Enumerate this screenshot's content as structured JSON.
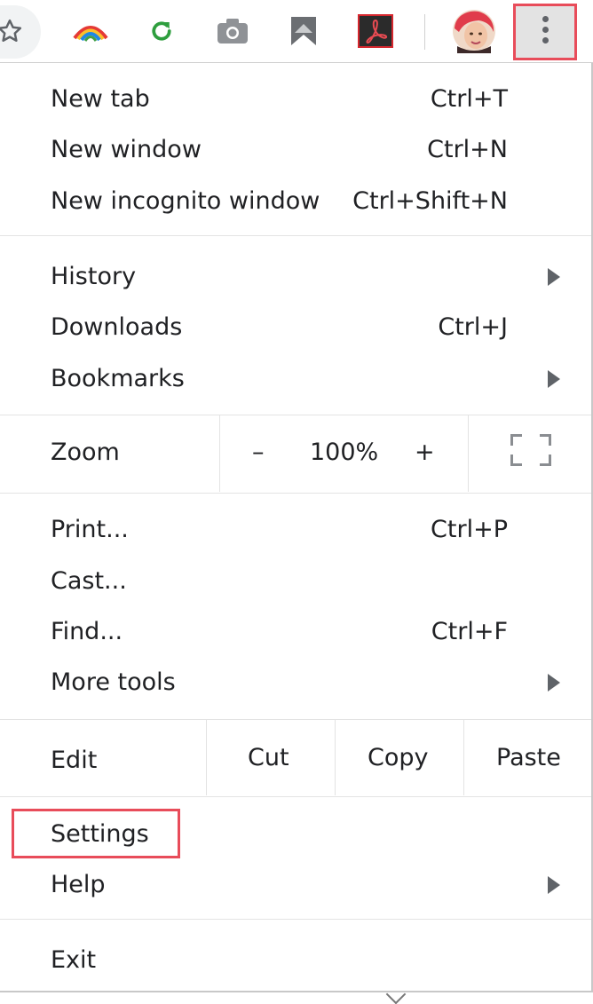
{
  "toolbar": {
    "icons": [
      "star-icon",
      "extension-rainbow-icon",
      "refresh-extension-icon",
      "camera-icon",
      "bookmark-arrow-icon",
      "acrobat-icon",
      "avatar",
      "more-vert-icon"
    ]
  },
  "menu": {
    "new_tab": {
      "label": "New tab",
      "shortcut": "Ctrl+T"
    },
    "new_window": {
      "label": "New window",
      "shortcut": "Ctrl+N"
    },
    "new_incognito": {
      "label": "New incognito window",
      "shortcut": "Ctrl+Shift+N"
    },
    "history": {
      "label": "History"
    },
    "downloads": {
      "label": "Downloads",
      "shortcut": "Ctrl+J"
    },
    "bookmarks": {
      "label": "Bookmarks"
    },
    "zoom": {
      "label": "Zoom",
      "minus": "–",
      "value": "100%",
      "plus": "+"
    },
    "print": {
      "label": "Print...",
      "shortcut": "Ctrl+P"
    },
    "cast": {
      "label": "Cast..."
    },
    "find": {
      "label": "Find...",
      "shortcut": "Ctrl+F"
    },
    "more_tools": {
      "label": "More tools"
    },
    "edit": {
      "label": "Edit",
      "cut": "Cut",
      "copy": "Copy",
      "paste": "Paste"
    },
    "settings": {
      "label": "Settings"
    },
    "help": {
      "label": "Help"
    },
    "exit": {
      "label": "Exit"
    }
  },
  "colors": {
    "highlight": "#e84c5a",
    "text": "#202124",
    "arrow": "#5f6368"
  }
}
